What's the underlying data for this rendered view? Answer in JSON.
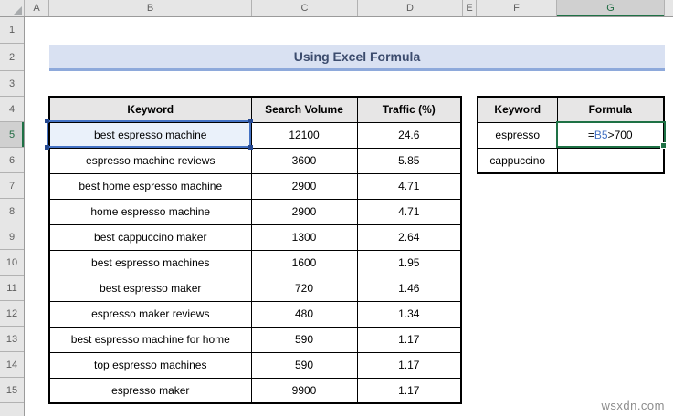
{
  "grid": {
    "columns": [
      "A",
      "B",
      "C",
      "D",
      "E",
      "F",
      "G"
    ],
    "rows": [
      "1",
      "2",
      "3",
      "4",
      "5",
      "6",
      "7",
      "8",
      "9",
      "10",
      "11",
      "12",
      "13",
      "14",
      "15"
    ],
    "active_column": "G",
    "active_row": "5",
    "active_cell": "G5",
    "referenced_cell": "B5"
  },
  "title": {
    "text": "Using Excel Formula"
  },
  "main_table": {
    "headers": [
      "Keyword",
      "Search Volume",
      "Traffic (%)"
    ],
    "rows": [
      [
        "best espresso machine",
        "12100",
        "24.6"
      ],
      [
        "espresso machine reviews",
        "3600",
        "5.85"
      ],
      [
        "best home espresso machine",
        "2900",
        "4.71"
      ],
      [
        "home espresso machine",
        "2900",
        "4.71"
      ],
      [
        "best cappuccino maker",
        "1300",
        "2.64"
      ],
      [
        "best espresso machines",
        "1600",
        "1.95"
      ],
      [
        "best espresso maker",
        "720",
        "1.46"
      ],
      [
        "espresso maker reviews",
        "480",
        "1.34"
      ],
      [
        "best espresso machine for home",
        "590",
        "1.17"
      ],
      [
        "top espresso machines",
        "590",
        "1.17"
      ],
      [
        "espresso maker",
        "9900",
        "1.17"
      ]
    ]
  },
  "formula_table": {
    "headers": [
      "Keyword",
      "Formula"
    ],
    "keywords": [
      "espresso",
      "cappuccino"
    ],
    "active_formula": {
      "equals": "=",
      "ref": "B5",
      "rest": ">700"
    }
  },
  "watermark": "wsxdn.com",
  "colors": {
    "accent_green": "#1E7145",
    "reference_blue": "#4472C4",
    "selection_handle_blue": "#24478F",
    "title_fill": "#D9E1F2",
    "title_border": "#8EA9DB",
    "title_text": "#3C4C6E",
    "header_gray": "#E6E6E6",
    "table_header_gray": "#E7E6E6"
  }
}
